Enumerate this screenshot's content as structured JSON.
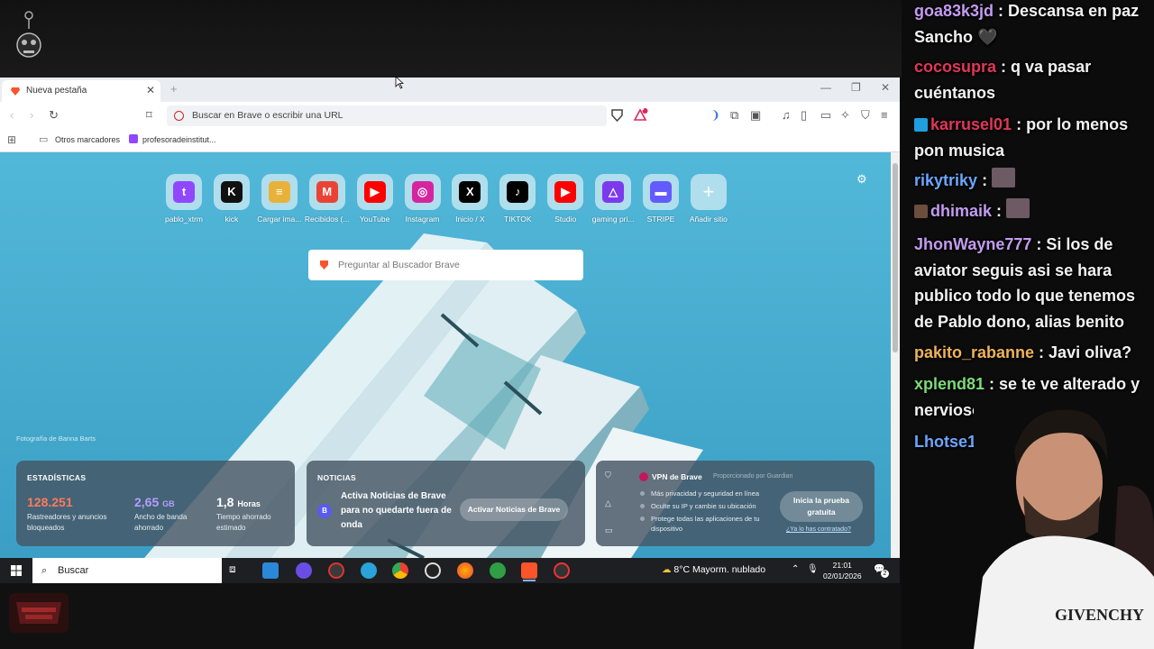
{
  "chat": [
    {
      "user": "goa83k3jd",
      "color": "#c49cf0",
      "text": "Descansa en paz Sancho 🖤",
      "badge": null
    },
    {
      "user": "cocosupra",
      "color": "#e0375a",
      "text": "q va pasar cuéntanos",
      "badge": null
    },
    {
      "user": "karrusel01",
      "color": "#e0375a",
      "text": "por lo menos pon musica",
      "badge": "prime"
    },
    {
      "user": "rikytriky",
      "color": "#6ba7ff",
      "text": "",
      "badge": null
    },
    {
      "user": "dhimaik",
      "color": "#c49cf0",
      "text": "",
      "badge": "sub"
    },
    {
      "user": "JhonWayne777",
      "color": "#c49cf0",
      "text": "Si los de aviator seguis asi se hara publico todo lo que tenemos de Pablo dono, alias benito",
      "badge": null
    },
    {
      "user": "pakito_rabanne",
      "color": "#f0b35a",
      "text": "Javi oliva?",
      "badge": null
    },
    {
      "user": "xplend81",
      "color": "#7cdc78",
      "text": "se te ve alterado y nervioso",
      "badge": null
    },
    {
      "user": "Lhotse1",
      "color": "#6ba7ff",
      "text": "",
      "badge": null
    }
  ],
  "browser": {
    "tab_title": "Nueva pestaña",
    "url_placeholder": "Buscar en Brave o escribir una URL",
    "bookmarks": [
      "Otros marcadores",
      "profesoradeinstitut..."
    ],
    "shield_count": "1",
    "top_sites": [
      {
        "label": "pablo_xtrm",
        "color": "#9146ff",
        "icon": "twitch-icon",
        "glyph": "t"
      },
      {
        "label": "kick",
        "color": "#111111",
        "icon": "kick-icon",
        "glyph": "K"
      },
      {
        "label": "Cargar ima...",
        "color": "#e8b23a",
        "icon": "layers-icon",
        "glyph": "≡"
      },
      {
        "label": "Recibidos (...",
        "color": "#ea4335",
        "icon": "gmail-icon",
        "glyph": "M"
      },
      {
        "label": "YouTube",
        "color": "#ff0000",
        "icon": "youtube-icon",
        "glyph": "▶"
      },
      {
        "label": "Instagram",
        "color": "#d6249f",
        "icon": "instagram-icon",
        "glyph": "◎"
      },
      {
        "label": "Inicio / X",
        "color": "#000000",
        "icon": "x-icon",
        "glyph": "X"
      },
      {
        "label": "TIKTOK",
        "color": "#000000",
        "icon": "tiktok-icon",
        "glyph": "♪"
      },
      {
        "label": "Studio",
        "color": "#ff0000",
        "icon": "youtube-studio-icon",
        "glyph": "▶"
      },
      {
        "label": "gaming pri...",
        "color": "#7c3aed",
        "icon": "gaming-icon",
        "glyph": "△"
      },
      {
        "label": "STRIPE",
        "color": "#635bff",
        "icon": "stripe-icon",
        "glyph": "▬"
      },
      {
        "label": "Añadir sitio",
        "color": "transparent",
        "icon": "plus-icon",
        "glyph": "+"
      }
    ],
    "ntp_search_placeholder": "Preguntar al Buscador Brave",
    "photo_credit": "Fotografía de Banna Barts",
    "stats": {
      "title": "ESTADÍSTICAS",
      "trackers_value": "128.251",
      "trackers_desc": "Rastreadores y anuncios bloqueados",
      "bandwidth_value": "2,65",
      "bandwidth_unit": "GB",
      "bandwidth_desc": "Ancho de banda ahorrado",
      "time_value": "1,8",
      "time_unit": "Horas",
      "time_desc": "Tiempo ahorrado estimado",
      "trackers_color": "#ff7a5c",
      "bandwidth_color": "#b59cff"
    },
    "news": {
      "title": "NOTICIAS",
      "avatar": "B",
      "text": "Activa Noticias de Brave para no quedarte fuera de onda",
      "button": "Activar Noticias de Brave"
    },
    "vpn": {
      "title": "VPN de Brave",
      "provided_by": "Proporcionado por  Guardian",
      "bullets": [
        "Más privacidad y seguridad en línea",
        "Oculte su IP y cambie su ubicación",
        "Protege todas las aplicaciones de tu dispositivo"
      ],
      "button": "Inicia la prueba gratuita",
      "link": "¿Ya lo has contratado?"
    }
  },
  "taskbar": {
    "search": "Buscar",
    "weather": "8°C  Mayorm. nublado",
    "time": "21:01",
    "date": "02/01/2026",
    "notification_count": "2"
  }
}
